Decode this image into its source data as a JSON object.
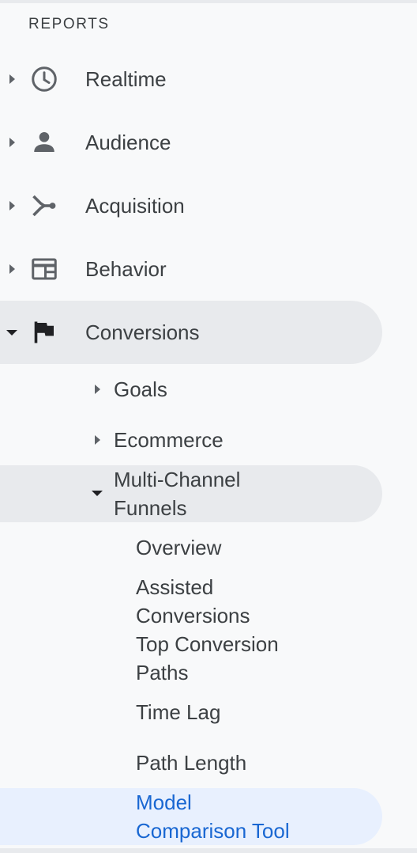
{
  "section": {
    "header": "REPORTS"
  },
  "nav": {
    "realtime": "Realtime",
    "audience": "Audience",
    "acquisition": "Acquisition",
    "behavior": "Behavior",
    "conversions": "Conversions"
  },
  "conversions": {
    "goals": "Goals",
    "ecommerce": "Ecommerce",
    "mcf_line1": "Multi-Channel",
    "mcf_line2": "Funnels"
  },
  "mcf": {
    "overview": "Overview",
    "assisted_1": "Assisted",
    "assisted_2": "Conversions",
    "top_1": "Top Conversion",
    "top_2": "Paths",
    "time_lag": "Time Lag",
    "path_length": "Path Length",
    "model_1": "Model",
    "model_2": "Comparison Tool"
  },
  "colors": {
    "background": "#f8f9fa",
    "selected_bg": "#e8eaed",
    "active_bg": "#e8f0fe",
    "active_text": "#1967d2"
  },
  "icons": [
    "clock-icon",
    "person-icon",
    "acquisition-icon",
    "behavior-icon",
    "flag-icon"
  ]
}
